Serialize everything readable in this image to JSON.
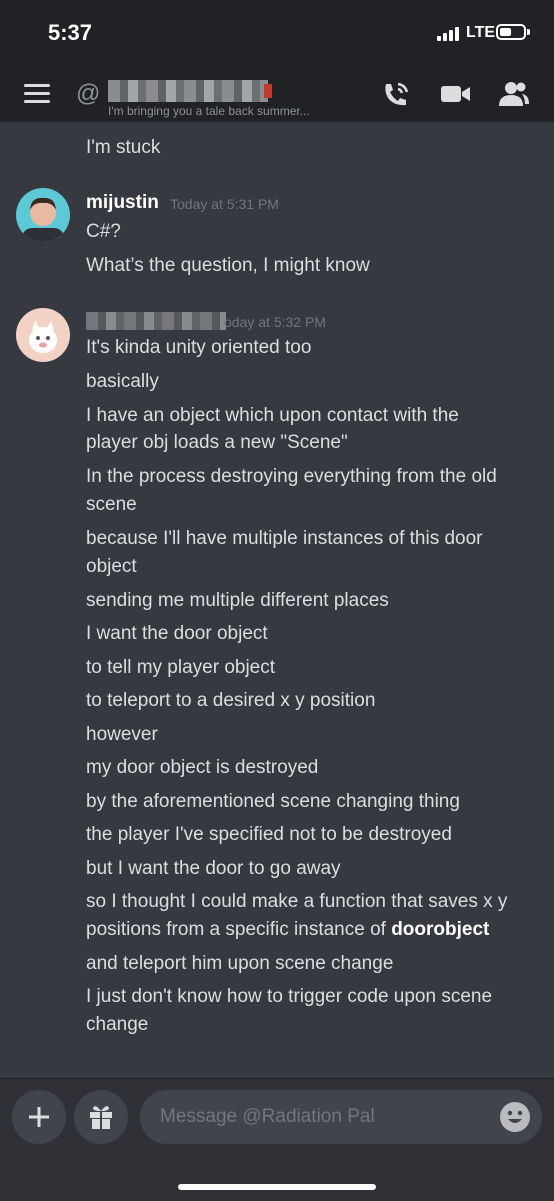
{
  "status_bar": {
    "time": "5:37",
    "network": "LTE"
  },
  "header": {
    "channel_prefix": "@",
    "status_text": "I'm bringing you a tale back summer..."
  },
  "icons": {
    "menu": "hamburger-icon",
    "call": "phone-call-icon",
    "video": "video-camera-icon",
    "members": "people-icon",
    "add": "plus-icon",
    "gift": "gift-icon",
    "emoji": "emoji-icon"
  },
  "messages": {
    "top_line": "I'm stuck",
    "group1": {
      "author": "mijustin",
      "timestamp": "Today at 5:31 PM",
      "lines": [
        "C#?",
        "What’s the question, I might know"
      ]
    },
    "group2": {
      "timestamp": "oday at 5:32 PM",
      "lines": [
        "It's kinda unity oriented too",
        "basically",
        "I have an object which upon contact with the",
        "player obj loads a new \"Scene\"",
        "In the process destroying everything from the old",
        "scene",
        "because I'll have multiple instances of this door",
        "object",
        "sending me multiple different places",
        "I want the door object",
        "to tell my player object",
        "to teleport to a desired x y position",
        "however",
        "my door object is destroyed",
        "by the aforementioned scene changing thing",
        "the player I've specified not to be destroyed",
        "but I want the door to go away",
        "so I thought I could make a function that saves x y",
        "positions from a specific instance of",
        "and teleport him upon scene change",
        "I just don't know how to trigger code upon scene",
        "change"
      ],
      "bold_word": "doorobject"
    }
  },
  "composer": {
    "placeholder": "Message @Radiation Pal"
  },
  "colors": {
    "background": "#36393f",
    "header": "#202225",
    "input": "#40444b"
  }
}
